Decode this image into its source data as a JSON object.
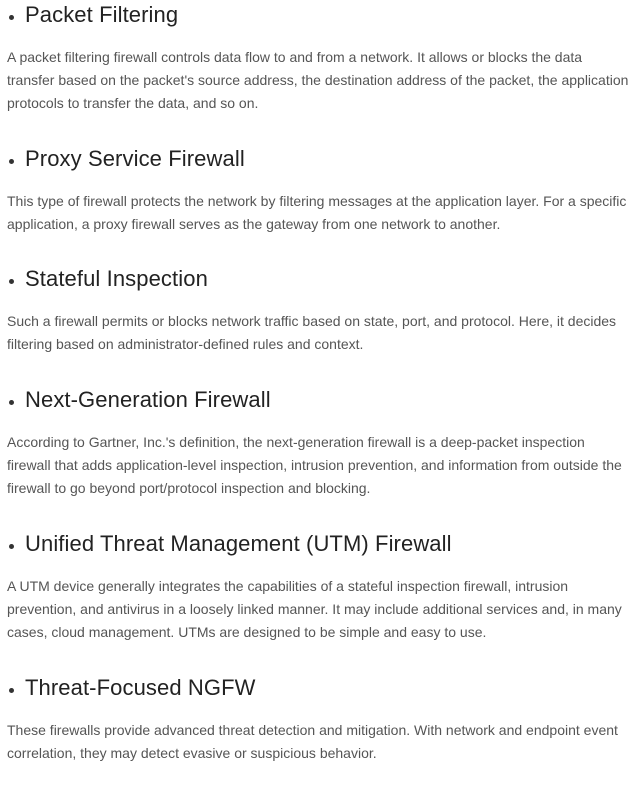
{
  "sections": [
    {
      "heading": "Packet Filtering",
      "body": "A packet filtering firewall controls data flow to and from a network. It allows or blocks the data transfer based on the packet's source address, the destination address of the packet, the application protocols to transfer the data, and so on."
    },
    {
      "heading": "Proxy Service Firewall",
      "body": "This type of firewall protects the network by filtering messages at the application layer. For a specific application, a proxy firewall serves as the gateway from one network to another."
    },
    {
      "heading": "Stateful Inspection",
      "body": "Such a firewall permits or blocks network traffic based on state, port, and protocol. Here, it decides filtering based on administrator-defined rules and context."
    },
    {
      "heading": "Next-Generation Firewall",
      "body": "According to Gartner, Inc.'s definition, the next-generation firewall is a deep-packet inspection firewall that adds application-level inspection, intrusion prevention, and information from outside the firewall to go beyond port/protocol inspection and blocking."
    },
    {
      "heading": "Unified Threat Management (UTM) Firewall",
      "body": "A UTM device generally integrates the capabilities of a stateful inspection firewall, intrusion prevention, and antivirus in a loosely linked manner. It may include additional services and, in many cases, cloud management. UTMs are designed to be simple and easy to use."
    },
    {
      "heading": "Threat-Focused NGFW",
      "body": "These firewalls provide advanced threat detection and mitigation. With network and endpoint event correlation, they may detect evasive or suspicious behavior."
    }
  ]
}
